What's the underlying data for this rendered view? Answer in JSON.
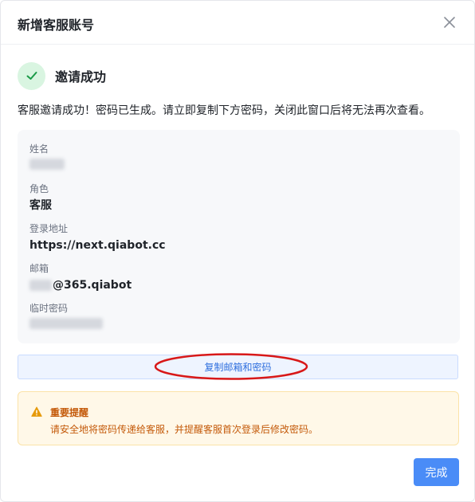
{
  "dialog": {
    "title": "新增客服账号",
    "close_icon": "close-icon"
  },
  "success": {
    "icon": "check-icon",
    "title": "邀请成功",
    "description": "客服邀请成功！密码已生成。请立即复制下方密码，关闭此窗口后将无法再次查看。"
  },
  "fields": {
    "name": {
      "label": "姓名",
      "value": ""
    },
    "role": {
      "label": "角色",
      "value": "客服"
    },
    "login_url": {
      "label": "登录地址",
      "value": "https://next.qiabot.cc"
    },
    "email": {
      "label": "邮箱",
      "value_suffix": "@365.qiabot"
    },
    "temp_password": {
      "label": "临时密码",
      "value": ""
    }
  },
  "actions": {
    "copy_label": "复制邮箱和密码",
    "done_label": "完成"
  },
  "notice": {
    "icon": "warning-icon",
    "title": "重要提醒",
    "text": "请安全地将密码传递给客服，并提醒客服首次登录后修改密码。"
  },
  "colors": {
    "accent": "#4a8cf7",
    "success_bg": "#d9f5e1",
    "success_check": "#1a9a47",
    "warning": "#e69a0a",
    "annotation": "#d81818"
  }
}
